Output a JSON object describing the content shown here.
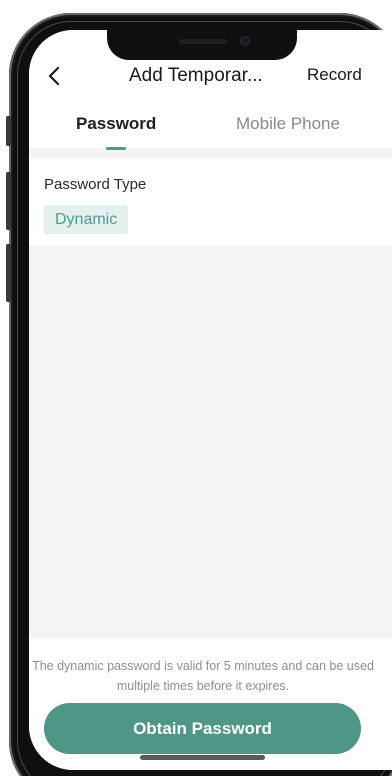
{
  "header": {
    "back_icon": "chevron-left-icon",
    "title": "Add Temporar...",
    "record_label": "Record"
  },
  "tabs": [
    {
      "label": "Password",
      "active": true
    },
    {
      "label": "Mobile Phone",
      "active": false
    }
  ],
  "password_type": {
    "label": "Password Type",
    "selected": "Dynamic"
  },
  "footer": {
    "hint": "The dynamic password is valid for 5 minutes and can be used multiple times before it expires.",
    "button_label": "Obtain Password"
  },
  "colors": {
    "accent": "#4e9b8c",
    "chip_background": "#e6f1ef",
    "page_background": "#f4f4f4"
  }
}
